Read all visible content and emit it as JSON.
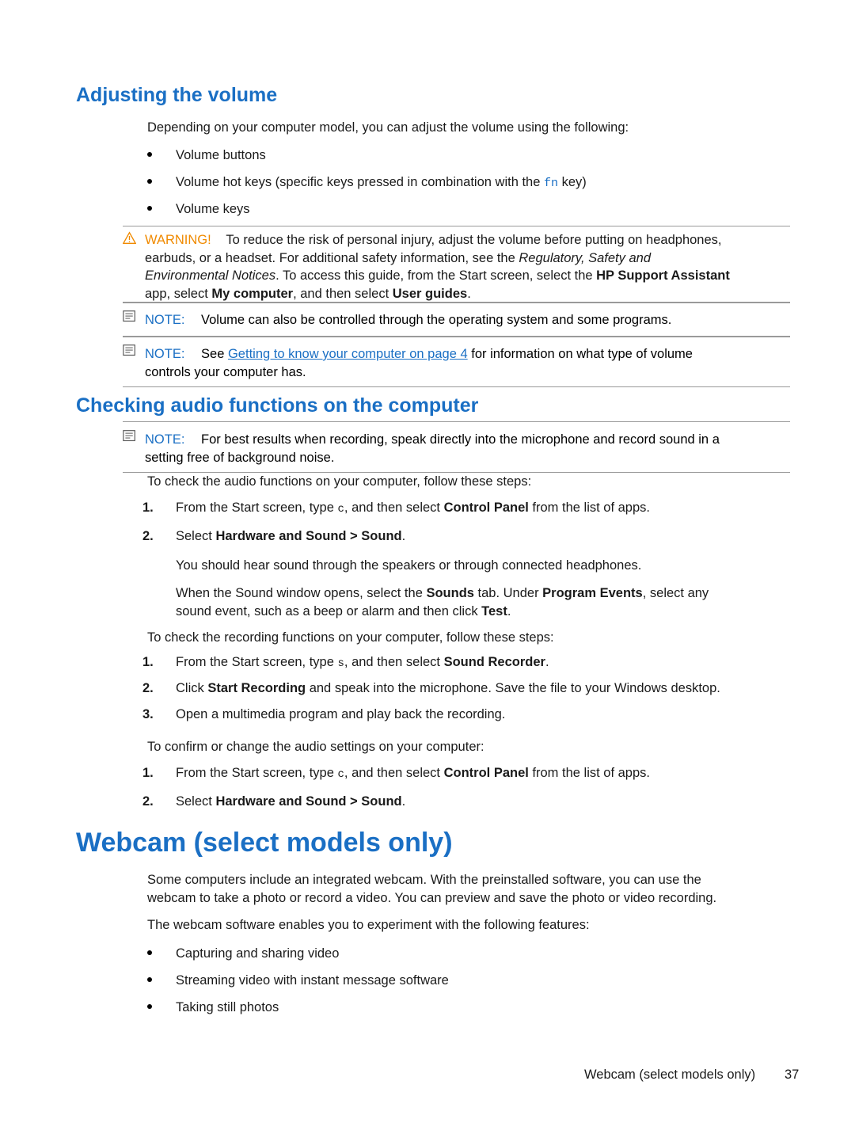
{
  "doc": {
    "heading_volume": "Adjusting the volume",
    "intro": "Depending on your computer model, you can adjust the volume using the following:",
    "volume_bullets": [
      "Volume buttons",
      "Volume keys"
    ],
    "hotkey_bullet_pre": "Volume hot keys (specific keys pressed in combination with the ",
    "hotkey_key": "fn",
    "hotkey_bullet_post": " key)",
    "warning": {
      "label": "WARNING!",
      "line1": "To reduce the risk of personal injury, adjust the volume before putting on headphones,",
      "line2a": "earbuds, or a headset. For additional safety information, see the ",
      "line2b": "Regulatory, Safety and",
      "line3a": "Environmental Notices",
      "line3b": ". To access this guide, from the Start screen, select the ",
      "line3c": "HP Support Assistant",
      "line4a": "app, select ",
      "line4b": "My computer",
      "line4c": ", and then select ",
      "line4d": "User guides",
      "line4e": "."
    },
    "note1": {
      "label": "NOTE:",
      "text": "Volume can also be controlled through the operating system and some programs."
    },
    "note2": {
      "label": "NOTE:",
      "text_pre": "See ",
      "link": "Getting to know your computer on page 4",
      "text_post": " for information on what type of volume",
      "line2": "controls your computer has."
    },
    "heading_audio": "Checking audio functions on the computer",
    "note3": {
      "label": "NOTE:",
      "line1": "For best results when recording, speak directly into the microphone and record sound in a",
      "line2": "setting free of background noise."
    },
    "audio_intro": "To check the audio functions on your computer, follow these steps:",
    "audio_steps": [
      {
        "num": "1.",
        "pre": "From the Start screen, type ",
        "mono": "c",
        "mid": ", and then select ",
        "bold": "Control Panel",
        "post": " from the list of apps."
      },
      {
        "num": "2.",
        "pre": "Select ",
        "bold": "Hardware and Sound > Sound",
        "post": "."
      }
    ],
    "audio_para1": "You should hear sound through the speakers or through connected headphones.",
    "audio_para2": {
      "a": "When the Sound window opens, select the ",
      "b": "Sounds",
      "c": " tab. Under ",
      "d": "Program Events",
      "e": ", select any",
      "line2a": "sound event, such as a beep or alarm and then click ",
      "line2b": "Test",
      "line2c": "."
    },
    "record_intro": "To check the recording functions on your computer, follow these steps:",
    "record_steps": [
      {
        "num": "1.",
        "pre": "From the Start screen, type ",
        "mono": "s",
        "mid": ", and then select ",
        "bold": "Sound Recorder",
        "post": "."
      },
      {
        "num": "2.",
        "pre": "Click ",
        "bold": "Start Recording",
        "post": " and speak into the microphone. Save the file to your Windows desktop."
      },
      {
        "num": "3.",
        "pre": "Open a multimedia program and play back the recording.",
        "bold": "",
        "post": ""
      }
    ],
    "confirm_intro": "To confirm or change the audio settings on your computer:",
    "confirm_steps": [
      {
        "num": "1.",
        "pre": "From the Start screen, type ",
        "mono": "c",
        "mid": ", and then select ",
        "bold": "Control Panel",
        "post": " from the list of apps."
      },
      {
        "num": "2.",
        "pre": "Select ",
        "bold": "Hardware and Sound > Sound",
        "post": "."
      }
    ],
    "heading_webcam": "Webcam (select models only)",
    "webcam_para1_l1": "Some computers include an integrated webcam. With the preinstalled software, you can use the",
    "webcam_para1_l2": "webcam to take a photo or record a video. You can preview and save the photo or video recording.",
    "webcam_para2": "The webcam software enables you to experiment with the following features:",
    "webcam_bullets": [
      "Capturing and sharing video",
      "Streaming video with instant message software",
      "Taking still photos"
    ],
    "footer_text": "Webcam (select models only)",
    "footer_page": "37"
  },
  "colors": {
    "heading": "#1a6fc4",
    "warning": "#f08a00",
    "rule": "#9a9a9a"
  }
}
